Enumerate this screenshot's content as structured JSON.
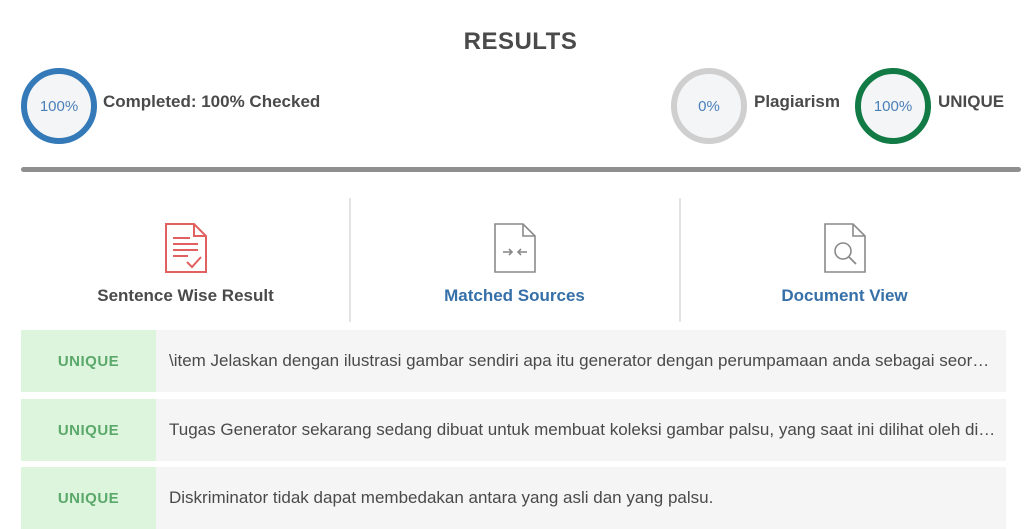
{
  "header": {
    "title": "RESULTS"
  },
  "stats": {
    "completed": {
      "value": "100%",
      "label": "Completed: 100% Checked",
      "color": "#3479b8"
    },
    "plagiarism": {
      "value": "0%",
      "label": "Plagiarism",
      "color": "#cfcfcf"
    },
    "unique": {
      "value": "100%",
      "label": "UNIQUE",
      "color": "#117a45"
    }
  },
  "tabs": [
    {
      "label": "Sentence Wise Result",
      "icon": "document-check-icon",
      "active": true
    },
    {
      "label": "Matched Sources",
      "icon": "compare-document-icon",
      "active": false
    },
    {
      "label": "Document View",
      "icon": "document-search-icon",
      "active": false
    }
  ],
  "sentences": [
    {
      "status": "UNIQUE",
      "text": "\\item Jelaskan dengan ilustrasi gambar sendiri apa itu generator dengan perumpamaan anda sebagai seorang pemalsu gambar"
    },
    {
      "status": "UNIQUE",
      "text": "Tugas Generator sekarang sedang dibuat untuk membuat koleksi gambar palsu, yang saat ini dilihat oleh diskriminator"
    },
    {
      "status": "UNIQUE",
      "text": "Diskriminator tidak dapat membedakan antara yang asli dan yang palsu."
    }
  ],
  "colors": {
    "accent_blue": "#3670a8",
    "unique_green": "#5aa86a",
    "unique_bg": "#ddf5dd",
    "icon_red": "#e0615f"
  }
}
